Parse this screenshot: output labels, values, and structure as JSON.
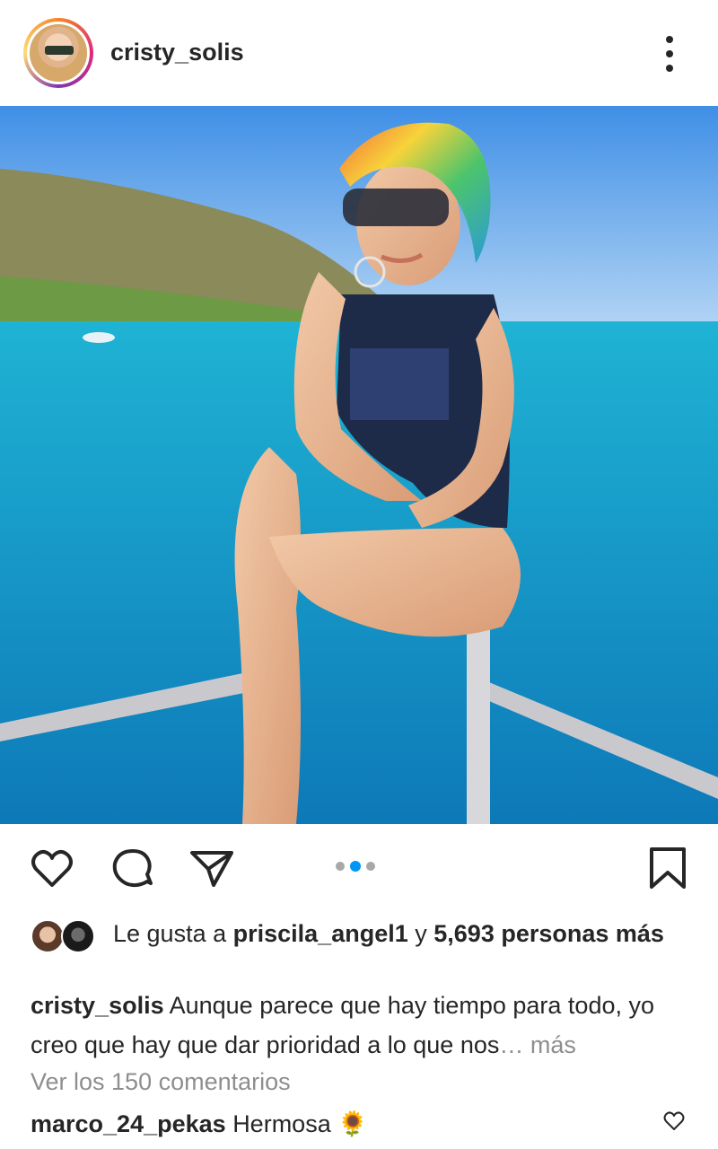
{
  "post": {
    "username": "cristy_solis",
    "likes": {
      "prefix": "Le gusta a",
      "liker": "priscila_angel1",
      "middle": "y",
      "count_text": "5,693 personas más"
    },
    "caption": {
      "username": "cristy_solis",
      "text": "Aunque parece que hay tiempo para todo, yo creo que hay que dar prioridad a lo que nos",
      "ellipsis": "…",
      "more": "más"
    },
    "view_comments": "Ver los 150 comentarios",
    "comment": {
      "username": "marco_24_pekas",
      "text": "Hermosa",
      "emoji": "🌻"
    },
    "carousel": {
      "count": 3,
      "active_index": 1
    }
  },
  "icons": {
    "like": "heart-icon",
    "comment": "comment-icon",
    "share": "send-icon",
    "save": "bookmark-icon",
    "options": "more-options-icon"
  },
  "colors": {
    "text": "#262626",
    "muted": "#8e8e8e",
    "accent": "#0095f6"
  }
}
